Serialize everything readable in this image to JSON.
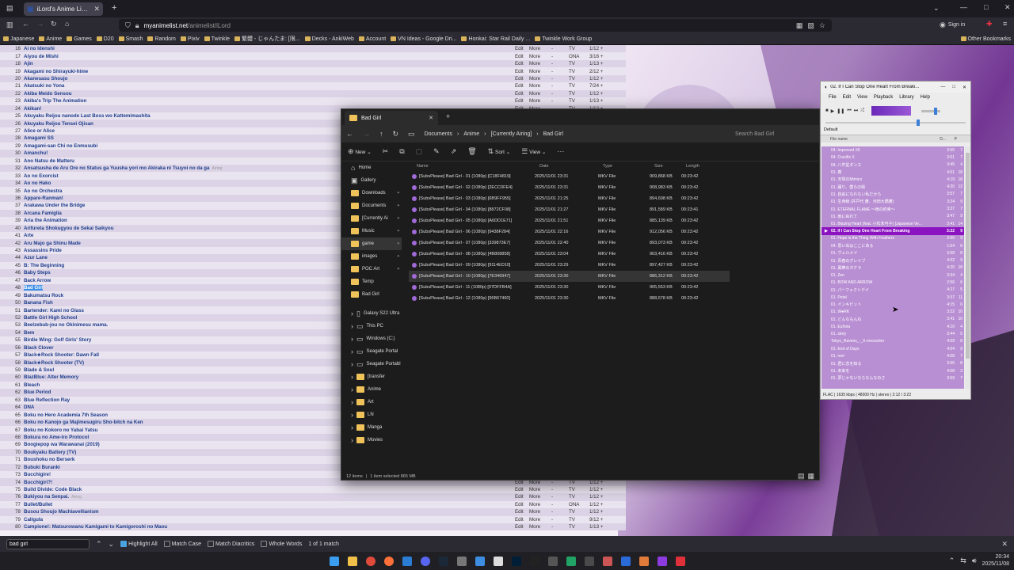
{
  "browser": {
    "tab_title": "iLord's Anime List - MyAnimeLi...",
    "url_host": "myanimelist.net",
    "url_path": "/animelist/iLord",
    "sign_in": "Sign in",
    "bookmarks": [
      "Japanese",
      "Anime",
      "Games",
      "D20",
      "Smash",
      "Random",
      "Pixiv",
      "Twinkle",
      "繁體 - じゃんたま: [限...",
      "Decks - AnkiWeb",
      "Account",
      "VN Ideas - Google Dri...",
      "Honkai: Star Rail Daily ...",
      "Twinkle Work Group"
    ],
    "other_bookmarks": "Other Bookmarks"
  },
  "anime_list": {
    "edit_label": "Edit",
    "more_label": "More",
    "dash": "-",
    "aired_label": "Airing",
    "highlight_title": "Bad Girl",
    "rows": [
      {
        "n": "16",
        "title": "Ai no Idenshi",
        "type": "TV",
        "ep": "1/12"
      },
      {
        "n": "17",
        "title": "Aiyou de Mishi",
        "type": "ONA",
        "ep": "3/16"
      },
      {
        "n": "18",
        "title": "Ajin",
        "type": "TV",
        "ep": "1/13"
      },
      {
        "n": "19",
        "title": "Akagami no Shirayuki-hime",
        "type": "TV",
        "ep": "2/12"
      },
      {
        "n": "20",
        "title": "Akanesasu Shoujo",
        "type": "TV",
        "ep": "1/12"
      },
      {
        "n": "21",
        "title": "Akatsuki no Yona",
        "type": "TV",
        "ep": "7/24"
      },
      {
        "n": "22",
        "title": "Akiba Meido Sensou",
        "type": "TV",
        "ep": "1/12"
      },
      {
        "n": "23",
        "title": "Akiba's Trip The Animation",
        "type": "TV",
        "ep": "1/13"
      },
      {
        "n": "24",
        "title": "Akikan!",
        "type": "TV",
        "ep": "1/12"
      },
      {
        "n": "25",
        "title": "Akuyaku Reijou nanode Last Boss wo Kattemimashita",
        "type": "TV",
        "ep": "1/12"
      },
      {
        "n": "26",
        "title": "Akuyaku Reijou Tensei Ojisan",
        "type": "TV",
        "ep": "1/12"
      },
      {
        "n": "27",
        "title": "Alice or Alice",
        "type": "TV",
        "ep": "1/12"
      },
      {
        "n": "28",
        "title": "Amagami SS",
        "type": "TV",
        "ep": "1/25"
      },
      {
        "n": "29",
        "title": "Amagami-san Chi no Enmusubi",
        "type": "TV",
        "ep": "2/24"
      },
      {
        "n": "30",
        "title": "Amanchu!",
        "type": "TV",
        "ep": "1/12"
      },
      {
        "n": "31",
        "title": "Ano Natsu de Matteru",
        "type": "TV",
        "ep": "1/12"
      },
      {
        "n": "32",
        "title": "Ansatsusha de Aru Ore no Status ga Yuusha yori mo Akiraka ni Tsuyoi no da ga",
        "type": "TV",
        "ep": "1/12",
        "airing": true
      },
      {
        "n": "33",
        "title": "Ao no Exorcist",
        "type": "TV",
        "ep": "1/25"
      },
      {
        "n": "34",
        "title": "Ao no Hako",
        "type": "TV",
        "ep": "1/25"
      },
      {
        "n": "35",
        "title": "Ao no Orchestra",
        "type": "TV",
        "ep": "1/24"
      },
      {
        "n": "36",
        "title": "Appare-Ranman!",
        "type": "TV",
        "ep": "1/13"
      },
      {
        "n": "37",
        "title": "Arakawa Under the Bridge",
        "type": "TV",
        "ep": "1/13"
      },
      {
        "n": "38",
        "title": "Arcana Famiglia",
        "type": "TV",
        "ep": "1/12"
      },
      {
        "n": "39",
        "title": "Aria the Animation",
        "type": "TV",
        "ep": "1/13"
      },
      {
        "n": "40",
        "title": "Arifureta Shokugyou de Sekai Saikyou",
        "type": "TV",
        "ep": "1/12"
      },
      {
        "n": "41",
        "title": "Arte",
        "type": "TV",
        "ep": "1/12"
      },
      {
        "n": "42",
        "title": "Aru Majo ga Shinu Made",
        "type": "TV",
        "ep": "1/12"
      },
      {
        "n": "43",
        "title": "Assassins Pride",
        "type": "TV",
        "ep": "1/12"
      },
      {
        "n": "44",
        "title": "Azur Lane",
        "type": "TV",
        "ep": "1/12"
      },
      {
        "n": "45",
        "title": "B: The Beginning",
        "type": "ONA",
        "ep": "1/12"
      },
      {
        "n": "46",
        "title": "Baby Steps",
        "type": "TV",
        "ep": "1/25"
      },
      {
        "n": "47",
        "title": "Back Arrow",
        "type": "TV",
        "ep": "1/24"
      },
      {
        "n": "48",
        "title": "Bad Girl",
        "type": "TV",
        "ep": "1/12",
        "hl": true
      },
      {
        "n": "49",
        "title": "Bakumatsu Rock",
        "type": "TV",
        "ep": "1/12"
      },
      {
        "n": "50",
        "title": "Banana Fish",
        "type": "TV",
        "ep": "1/24"
      },
      {
        "n": "51",
        "title": "Bartender: Kami no Glass",
        "type": "TV",
        "ep": "1/12"
      },
      {
        "n": "52",
        "title": "Battle Girl High School",
        "type": "TV",
        "ep": "1/12"
      },
      {
        "n": "53",
        "title": "Beelzebub-jou no Okinimesu mama.",
        "type": "TV",
        "ep": "1/12"
      },
      {
        "n": "54",
        "title": "Bem",
        "type": "TV",
        "ep": "1/12"
      },
      {
        "n": "55",
        "title": "Birdie Wing: Golf Girls' Story",
        "type": "TV",
        "ep": "1/13"
      },
      {
        "n": "56",
        "title": "Black Clover",
        "type": "TV",
        "ep": "1/170"
      },
      {
        "n": "57",
        "title": "Black★Rock Shooter: Dawn Fall",
        "type": "TV",
        "ep": "1/12"
      },
      {
        "n": "58",
        "title": "Black★Rock Shooter (TV)",
        "type": "TV",
        "ep": "1/8"
      },
      {
        "n": "59",
        "title": "Blade & Soul",
        "type": "TV",
        "ep": "1/13"
      },
      {
        "n": "60",
        "title": "BlazBlue: Alter Memory",
        "type": "TV",
        "ep": "1/12"
      },
      {
        "n": "61",
        "title": "Bleach",
        "type": "TV",
        "ep": "1/366"
      },
      {
        "n": "62",
        "title": "Blue Period",
        "type": "TV",
        "ep": "1/12"
      },
      {
        "n": "63",
        "title": "Blue Reflection Ray",
        "type": "TV",
        "ep": "1/24"
      },
      {
        "n": "64",
        "title": "DNA",
        "type": "TV",
        "ep": "1/12"
      },
      {
        "n": "65",
        "title": "Boku no Hero Academia 7th Season",
        "type": "TV",
        "ep": "1/21"
      },
      {
        "n": "66",
        "title": "Boku no Kanojo ga Majimesugiru Sho-bitch na Ken",
        "type": "TV",
        "ep": "1/10"
      },
      {
        "n": "67",
        "title": "Boku no Kokoro no Yabai Yatsu",
        "type": "TV",
        "ep": "1/12"
      },
      {
        "n": "68",
        "title": "Bokura no Ame-iro Protocol",
        "type": "TV",
        "ep": "1/12"
      },
      {
        "n": "69",
        "title": "Boogiepop wa Warawanai (2019)",
        "type": "TV",
        "ep": "1/18"
      },
      {
        "n": "70",
        "title": "Boukyaku Battery (TV)",
        "type": "TV",
        "ep": "1/12"
      },
      {
        "n": "71",
        "title": "Boushoku no Berserk",
        "type": "TV",
        "ep": "1/12"
      },
      {
        "n": "72",
        "title": "Bubuki Buranki",
        "type": "TV",
        "ep": "1/12"
      },
      {
        "n": "73",
        "title": "Bucchigire!",
        "type": "TV",
        "ep": "1/12"
      },
      {
        "n": "74",
        "title": "Bucchigiri?!",
        "type": "TV",
        "ep": "1/12"
      },
      {
        "n": "75",
        "title": "Build Divide: Code Black",
        "type": "TV",
        "ep": "1/12"
      },
      {
        "n": "76",
        "title": "Bukiyou na Senpai.",
        "type": "TV",
        "ep": "1/12",
        "airing": true
      },
      {
        "n": "77",
        "title": "Bullet/Bullet",
        "type": "ONA",
        "ep": "1/12"
      },
      {
        "n": "78",
        "title": "Busou Shoujo Machiavellianism",
        "type": "TV",
        "ep": "1/12"
      },
      {
        "n": "79",
        "title": "Caligula",
        "type": "TV",
        "ep": "9/12"
      },
      {
        "n": "80",
        "title": "Campione!: Matsurowanu Kamigami to Kamigoroshi no Maou",
        "type": "TV",
        "ep": "1/13"
      }
    ]
  },
  "find_bar": {
    "query": "bad girl",
    "highlight_all": "Highlight All",
    "match_case": "Match Case",
    "match_diacritics": "Match Diacritics",
    "whole_words": "Whole Words",
    "result": "1 of 1 match"
  },
  "explorer": {
    "tab_title": "Bad Girl",
    "breadcrumb": [
      "Documents",
      "Anime",
      "[Currently Airing]",
      "Bad Girl"
    ],
    "search_placeholder": "Search Bad Girl",
    "new_label": "New",
    "sort_label": "Sort",
    "view_label": "View",
    "columns": {
      "name": "Name",
      "date": "Date",
      "type": "Type",
      "size": "Size",
      "length": "Length"
    },
    "nav": [
      {
        "label": "Home",
        "kind": "home"
      },
      {
        "label": "Gallery",
        "kind": "gallery"
      },
      {
        "label": "Downloads",
        "kind": "folder",
        "pin": true
      },
      {
        "label": "Documents",
        "kind": "folder",
        "pin": true
      },
      {
        "label": "[Currently Ai",
        "kind": "folder",
        "pin": true
      },
      {
        "label": "Music",
        "kind": "folder",
        "pin": true
      },
      {
        "label": "game",
        "kind": "folder",
        "pin": true,
        "sel": true
      },
      {
        "label": "images",
        "kind": "folder",
        "pin": true
      },
      {
        "label": "POC Art",
        "kind": "folder",
        "pin": true
      },
      {
        "label": "Temp",
        "kind": "folder"
      },
      {
        "label": "Bad Girl",
        "kind": "folder"
      },
      {
        "label": "",
        "kind": "gap"
      },
      {
        "label": "Galaxy S22 Ultra",
        "kind": "device"
      },
      {
        "label": "This PC",
        "kind": "pc"
      },
      {
        "label": "Windows (C:)",
        "kind": "drive"
      },
      {
        "label": "Seagate Portal",
        "kind": "drive"
      },
      {
        "label": "Seagate Portabl",
        "kind": "drive"
      },
      {
        "label": "[transfer",
        "kind": "folder"
      },
      {
        "label": "Anime",
        "kind": "folder"
      },
      {
        "label": "Art",
        "kind": "folder"
      },
      {
        "label": "LN",
        "kind": "folder"
      },
      {
        "label": "Manga",
        "kind": "folder"
      },
      {
        "label": "Movies",
        "kind": "folder"
      }
    ],
    "files": [
      {
        "name": "[SubsPlease] Bad Girl - 01 (1080p) [C18F4819]",
        "date": "2025/11/01 23:31",
        "type": "MKV File",
        "size": "909,868 KB",
        "length": "00:23:42"
      },
      {
        "name": "[SubsPlease] Bad Girl - 02 (1080p) [2ECC0FE4]",
        "date": "2025/11/01 23:31",
        "type": "MKV File",
        "size": "908,983 KB",
        "length": "00:23:42"
      },
      {
        "name": "[SubsPlease] Bad Girl - 03 (1080p) [6B9FF955]",
        "date": "2025/11/01 21:25",
        "type": "MKV File",
        "size": "894,698 KB",
        "length": "00:23:42"
      },
      {
        "name": "[SubsPlease] Bad Girl - 04 (1080p) [8872CF08]",
        "date": "2025/11/01 21:27",
        "type": "MKV File",
        "size": "891,589 KB",
        "length": "00:23:41"
      },
      {
        "name": "[SubsPlease] Bad Girl - 05 (1080p) [A0DD1E71]",
        "date": "2025/11/01 21:51",
        "type": "MKV File",
        "size": "885,139 KB",
        "length": "00:23:42"
      },
      {
        "name": "[SubsPlease] Bad Girl - 06 (1080p) [9438F284]",
        "date": "2025/11/01 22:16",
        "type": "MKV File",
        "size": "912,056 KB",
        "length": "00:23:42"
      },
      {
        "name": "[SubsPlease] Bad Girl - 07 (1080p) [339873E7]",
        "date": "2025/11/01 22:40",
        "type": "MKV File",
        "size": "893,073 KB",
        "length": "00:23:42"
      },
      {
        "name": "[SubsPlease] Bad Girl - 08 (1080p) [4B808858]",
        "date": "2025/11/01 23:04",
        "type": "MKV File",
        "size": "903,416 KB",
        "length": "00:23:42"
      },
      {
        "name": "[SubsPlease] Bad Girl - 09 (1080p) [9114ED10]",
        "date": "2025/11/01 23:29",
        "type": "MKV File",
        "size": "897,427 KB",
        "length": "00:23:42"
      },
      {
        "name": "[SubsPlease] Bad Girl - 10 (1080p) [7E346947]",
        "date": "2025/11/01 23:30",
        "type": "MKV File",
        "size": "886,312 KB",
        "length": "00:23:42",
        "sel": true
      },
      {
        "name": "[SubsPlease] Bad Girl - 11 (1080p) [07DFFB4A]",
        "date": "2025/11/01 23:30",
        "type": "MKV File",
        "size": "905,553 KB",
        "length": "00:23:42"
      },
      {
        "name": "[SubsPlease] Bad Girl - 12 (1080p) [96B67460]",
        "date": "2025/11/01 23:30",
        "type": "MKV File",
        "size": "888,678 KB",
        "length": "00:23:42"
      }
    ],
    "status_items": "12 items",
    "status_selected": "1 item selected  865 MB"
  },
  "foobar": {
    "title": "02. If I Can Stop One Heart From Breaki...",
    "menu": [
      "File",
      "Edit",
      "View",
      "Playback",
      "Library",
      "Help"
    ],
    "playlist_tab": "Default",
    "col_name": "File name",
    "col_dur": "D...",
    "col_p": "P",
    "tracks": [
      {
        "name": "04. Improved XII",
        "dur": "3:55",
        "c": "7"
      },
      {
        "name": "04. Crucifix X",
        "dur": "3:01",
        "c": "7"
      },
      {
        "name": "04. 八芒星ダンス",
        "dur": "3:45",
        "c": "4"
      },
      {
        "name": "01. 廃",
        "dur": "4:01",
        "c": "18"
      },
      {
        "name": "01. 天球のMimico",
        "dur": "4:19",
        "c": "18"
      },
      {
        "name": "01. 踊り、僕らの街",
        "dur": "4:20",
        "c": "12"
      },
      {
        "name": "01. 自由になれない私だから",
        "dur": "3:57",
        "c": "7"
      },
      {
        "name": "01. 生命線 (井戸代 蒼、河田大橋蒼)",
        "dur": "3:24",
        "c": "9"
      },
      {
        "name": "01. ETERNAL FLAME ～雨の約束～",
        "dur": "3:27",
        "c": "7"
      },
      {
        "name": "01. 雨にぬれて",
        "dur": "3:47",
        "c": "9"
      },
      {
        "name": "01. Blazing Heart (feat. 小松未可子) [Japanese Ve...",
        "dur": "3:41",
        "c": "14"
      },
      {
        "name": "02. If I Can Stop One Heart From Breaking",
        "dur": "3:22",
        "c": "9",
        "now": true
      },
      {
        "name": "01. Hope is the Thing With Feathers",
        "dur": "3:50",
        "c": "9"
      },
      {
        "name": "04. 思い出はここにある",
        "dur": "1:54",
        "c": "8"
      },
      {
        "name": "01. ヴェルメイ",
        "dur": "3:58",
        "c": "8"
      },
      {
        "name": "01. 青春のグレイブ",
        "dur": "4:02",
        "c": "9"
      },
      {
        "name": "01. 風華のカケラ",
        "dur": "4:20",
        "c": "18"
      },
      {
        "name": "01. Zen",
        "dur": "3:34",
        "c": "4"
      },
      {
        "name": "01. BOW AND ARROW",
        "dur": "2:56",
        "c": "6"
      },
      {
        "name": "01. パーフェクトデイ",
        "dur": "4:27",
        "c": "5"
      },
      {
        "name": "01. Petal",
        "dur": "3:37",
        "c": "11"
      },
      {
        "name": "01. インキビット",
        "dur": "4:15",
        "c": "6"
      },
      {
        "name": "01. W●RK",
        "dur": "3:22",
        "c": "10"
      },
      {
        "name": "01. どんなもんね",
        "dur": "3:41",
        "c": "10"
      },
      {
        "name": "01. Euforia",
        "dur": "4:10",
        "c": "4"
      },
      {
        "name": "01. story",
        "dur": "3:44",
        "c": "5"
      },
      {
        "name": "Tokyo_Ravens_-_X-encounter",
        "dur": "4:09",
        "c": "8"
      },
      {
        "name": "01. End of Days",
        "dur": "4:04",
        "c": "9"
      },
      {
        "name": "01. reel",
        "dur": "4:08",
        "c": "7"
      },
      {
        "name": "01. 君に恋を知る",
        "dur": "3:55",
        "c": "8"
      },
      {
        "name": "01. 未来を",
        "dur": "4:08",
        "c": "3"
      },
      {
        "name": "01. 夢じゃないならなんなのさ",
        "dur": "3:59",
        "c": "7"
      }
    ],
    "status": "FLAC | 1635 kbps | 48000 Hz | stereo | 2:12 / 3:22",
    "seek_fraction": 0.65
  },
  "tray": {
    "time": "20:34",
    "date": "2025/11/08"
  },
  "colors": {
    "accent": "#8b13c0",
    "playlist_bg": "#b98fd3",
    "list_title": "#1d3d8c"
  }
}
